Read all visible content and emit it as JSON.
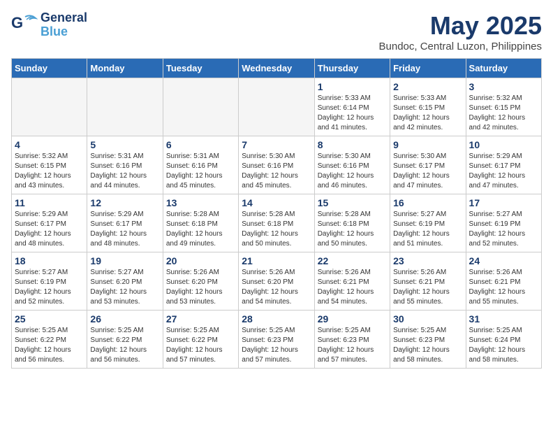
{
  "header": {
    "logo_general": "General",
    "logo_blue": "Blue",
    "month_title": "May 2025",
    "location": "Bundoc, Central Luzon, Philippines"
  },
  "weekdays": [
    "Sunday",
    "Monday",
    "Tuesday",
    "Wednesday",
    "Thursday",
    "Friday",
    "Saturday"
  ],
  "weeks": [
    [
      {
        "day": "",
        "info": ""
      },
      {
        "day": "",
        "info": ""
      },
      {
        "day": "",
        "info": ""
      },
      {
        "day": "",
        "info": ""
      },
      {
        "day": "1",
        "info": "Sunrise: 5:33 AM\nSunset: 6:14 PM\nDaylight: 12 hours\nand 41 minutes."
      },
      {
        "day": "2",
        "info": "Sunrise: 5:33 AM\nSunset: 6:15 PM\nDaylight: 12 hours\nand 42 minutes."
      },
      {
        "day": "3",
        "info": "Sunrise: 5:32 AM\nSunset: 6:15 PM\nDaylight: 12 hours\nand 42 minutes."
      }
    ],
    [
      {
        "day": "4",
        "info": "Sunrise: 5:32 AM\nSunset: 6:15 PM\nDaylight: 12 hours\nand 43 minutes."
      },
      {
        "day": "5",
        "info": "Sunrise: 5:31 AM\nSunset: 6:16 PM\nDaylight: 12 hours\nand 44 minutes."
      },
      {
        "day": "6",
        "info": "Sunrise: 5:31 AM\nSunset: 6:16 PM\nDaylight: 12 hours\nand 45 minutes."
      },
      {
        "day": "7",
        "info": "Sunrise: 5:30 AM\nSunset: 6:16 PM\nDaylight: 12 hours\nand 45 minutes."
      },
      {
        "day": "8",
        "info": "Sunrise: 5:30 AM\nSunset: 6:16 PM\nDaylight: 12 hours\nand 46 minutes."
      },
      {
        "day": "9",
        "info": "Sunrise: 5:30 AM\nSunset: 6:17 PM\nDaylight: 12 hours\nand 47 minutes."
      },
      {
        "day": "10",
        "info": "Sunrise: 5:29 AM\nSunset: 6:17 PM\nDaylight: 12 hours\nand 47 minutes."
      }
    ],
    [
      {
        "day": "11",
        "info": "Sunrise: 5:29 AM\nSunset: 6:17 PM\nDaylight: 12 hours\nand 48 minutes."
      },
      {
        "day": "12",
        "info": "Sunrise: 5:29 AM\nSunset: 6:17 PM\nDaylight: 12 hours\nand 48 minutes."
      },
      {
        "day": "13",
        "info": "Sunrise: 5:28 AM\nSunset: 6:18 PM\nDaylight: 12 hours\nand 49 minutes."
      },
      {
        "day": "14",
        "info": "Sunrise: 5:28 AM\nSunset: 6:18 PM\nDaylight: 12 hours\nand 50 minutes."
      },
      {
        "day": "15",
        "info": "Sunrise: 5:28 AM\nSunset: 6:18 PM\nDaylight: 12 hours\nand 50 minutes."
      },
      {
        "day": "16",
        "info": "Sunrise: 5:27 AM\nSunset: 6:19 PM\nDaylight: 12 hours\nand 51 minutes."
      },
      {
        "day": "17",
        "info": "Sunrise: 5:27 AM\nSunset: 6:19 PM\nDaylight: 12 hours\nand 52 minutes."
      }
    ],
    [
      {
        "day": "18",
        "info": "Sunrise: 5:27 AM\nSunset: 6:19 PM\nDaylight: 12 hours\nand 52 minutes."
      },
      {
        "day": "19",
        "info": "Sunrise: 5:27 AM\nSunset: 6:20 PM\nDaylight: 12 hours\nand 53 minutes."
      },
      {
        "day": "20",
        "info": "Sunrise: 5:26 AM\nSunset: 6:20 PM\nDaylight: 12 hours\nand 53 minutes."
      },
      {
        "day": "21",
        "info": "Sunrise: 5:26 AM\nSunset: 6:20 PM\nDaylight: 12 hours\nand 54 minutes."
      },
      {
        "day": "22",
        "info": "Sunrise: 5:26 AM\nSunset: 6:21 PM\nDaylight: 12 hours\nand 54 minutes."
      },
      {
        "day": "23",
        "info": "Sunrise: 5:26 AM\nSunset: 6:21 PM\nDaylight: 12 hours\nand 55 minutes."
      },
      {
        "day": "24",
        "info": "Sunrise: 5:26 AM\nSunset: 6:21 PM\nDaylight: 12 hours\nand 55 minutes."
      }
    ],
    [
      {
        "day": "25",
        "info": "Sunrise: 5:25 AM\nSunset: 6:22 PM\nDaylight: 12 hours\nand 56 minutes."
      },
      {
        "day": "26",
        "info": "Sunrise: 5:25 AM\nSunset: 6:22 PM\nDaylight: 12 hours\nand 56 minutes."
      },
      {
        "day": "27",
        "info": "Sunrise: 5:25 AM\nSunset: 6:22 PM\nDaylight: 12 hours\nand 57 minutes."
      },
      {
        "day": "28",
        "info": "Sunrise: 5:25 AM\nSunset: 6:23 PM\nDaylight: 12 hours\nand 57 minutes."
      },
      {
        "day": "29",
        "info": "Sunrise: 5:25 AM\nSunset: 6:23 PM\nDaylight: 12 hours\nand 57 minutes."
      },
      {
        "day": "30",
        "info": "Sunrise: 5:25 AM\nSunset: 6:23 PM\nDaylight: 12 hours\nand 58 minutes."
      },
      {
        "day": "31",
        "info": "Sunrise: 5:25 AM\nSunset: 6:24 PM\nDaylight: 12 hours\nand 58 minutes."
      }
    ]
  ]
}
